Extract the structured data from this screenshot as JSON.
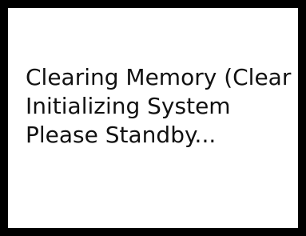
{
  "display": {
    "lines": [
      "Clearing Memory (Clear",
      "Initializing System",
      "Please Standby..."
    ]
  }
}
